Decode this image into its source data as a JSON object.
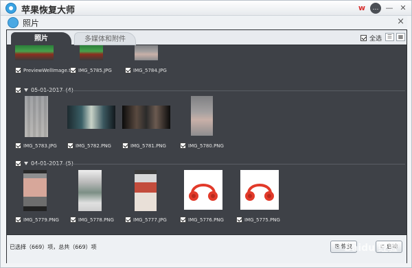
{
  "app": {
    "title": "苹果恢复大师"
  },
  "subwindow": {
    "title": "照片",
    "close": "×"
  },
  "tabs": [
    {
      "label": "照片"
    },
    {
      "label": "多媒体和附件"
    }
  ],
  "select_all": {
    "label": "全选"
  },
  "top_items": [
    {
      "name": "PreviewWellImage.tif"
    },
    {
      "name": "IMG_5785.JPG"
    },
    {
      "name": "IMG_5784.JPG"
    }
  ],
  "groups": [
    {
      "date": "05-01-2017",
      "count": "(4)",
      "items": [
        {
          "name": "IMG_5783.JPG"
        },
        {
          "name": "IMG_5782.PNG"
        },
        {
          "name": "IMG_5781.PNG"
        },
        {
          "name": "IMG_5780.PNG"
        }
      ]
    },
    {
      "date": "04-01-2017",
      "count": "(5)",
      "items": [
        {
          "name": "IMG_5779.PNG"
        },
        {
          "name": "IMG_5778.PNG"
        },
        {
          "name": "IMG_5777.JPG"
        },
        {
          "name": "IMG_5776.PNG"
        },
        {
          "name": "IMG_5775.PNG"
        }
      ]
    }
  ],
  "status": {
    "text": "已选择（669）项，总共（669）项"
  },
  "buttons": {
    "recover": "恢复",
    "cancel": "启动"
  },
  "watermark": "Baidu 经验"
}
